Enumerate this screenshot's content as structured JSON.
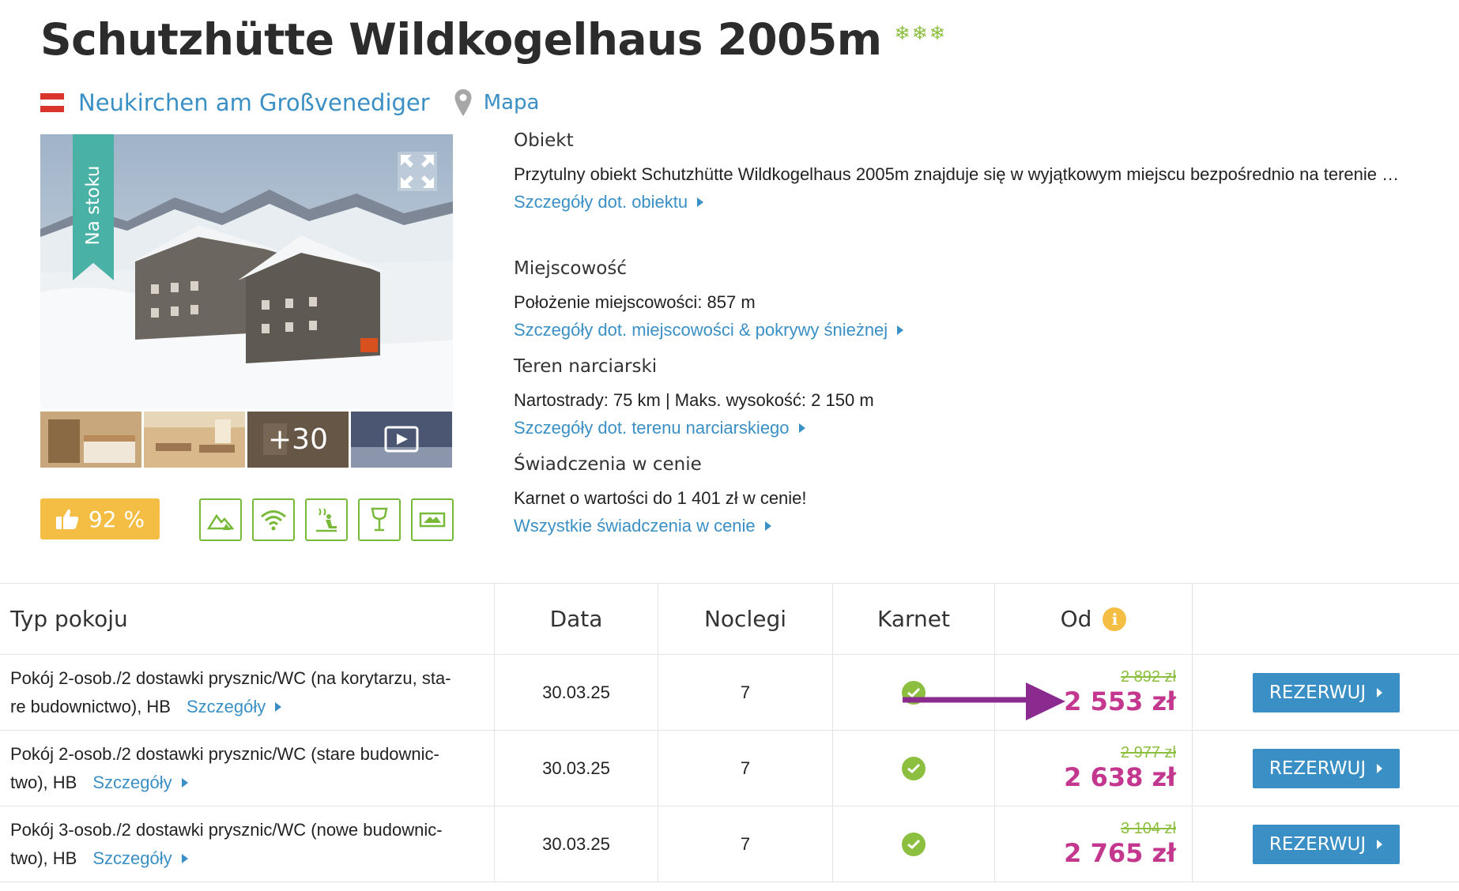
{
  "hotel": {
    "name": "Schutzhütte Wildkogelhaus 2005m",
    "stars": "❄❄❄",
    "location": "Neukirchen am Großvenediger",
    "map_label": "Mapa",
    "ribbon": "Na stoku",
    "more_photos": "+30",
    "rating": "92 %"
  },
  "info": {
    "obiekt": {
      "heading": "Obiekt",
      "text": "Przytulny obiekt Schutzhütte Wildkogelhaus 2005m znajduje się w wyjątkowym miejscu bezpośrednio na terenie …",
      "link": "Szczegóły dot. obiektu"
    },
    "miejscowosc": {
      "heading": "Miejscowość",
      "text": "Położenie miejscowości: 857 m",
      "link": "Szczegóły dot. miejscowości & pokrywy śnieżnej"
    },
    "teren": {
      "heading": "Teren narciarski",
      "text": "Nartostrady: 75 km | Maks. wysokość: 2 150 m",
      "link": "Szczegóły dot. terenu narciarskiego"
    },
    "swiadczenia": {
      "heading": "Świadczenia w cenie",
      "text": "Karnet o wartości do 1 401 zł w cenie!",
      "link": "Wszystkie świadczenia w cenie"
    }
  },
  "table": {
    "headers": {
      "room": "Typ pokoju",
      "date": "Data",
      "nights": "Noclegi",
      "pass": "Karnet",
      "from": "Od"
    },
    "details_label": "Szczegóły",
    "book_label": "REZERWUJ",
    "rows": [
      {
        "room_line1": "Pokój 2-osob./2 dostawki prysznic/WC (na korytarzu, sta-",
        "room_line2": "re budownictwo), HB",
        "date": "30.03.25",
        "nights": "7",
        "old_price": "2 892 zł",
        "new_price": "2 553 zł"
      },
      {
        "room_line1": "Pokój 2-osob./2 dostawki prysznic/WC (stare budownic-",
        "room_line2": "two), HB",
        "date": "30.03.25",
        "nights": "7",
        "old_price": "2 977 zł",
        "new_price": "2 638 zł"
      },
      {
        "room_line1": "Pokój 3-osob./2 dostawki prysznic/WC (nowe budownic-",
        "room_line2": "two), HB",
        "date": "30.03.25",
        "nights": "7",
        "old_price": "3 104 zł",
        "new_price": "2 765 zł"
      }
    ]
  },
  "colors": {
    "accent_blue": "#3a8fc4",
    "price_magenta": "#c3378e",
    "green": "#8cbf3f",
    "yellow": "#f4be44",
    "ribbon_teal": "#49b1a5",
    "arrow_purple": "#8b2a8f"
  }
}
